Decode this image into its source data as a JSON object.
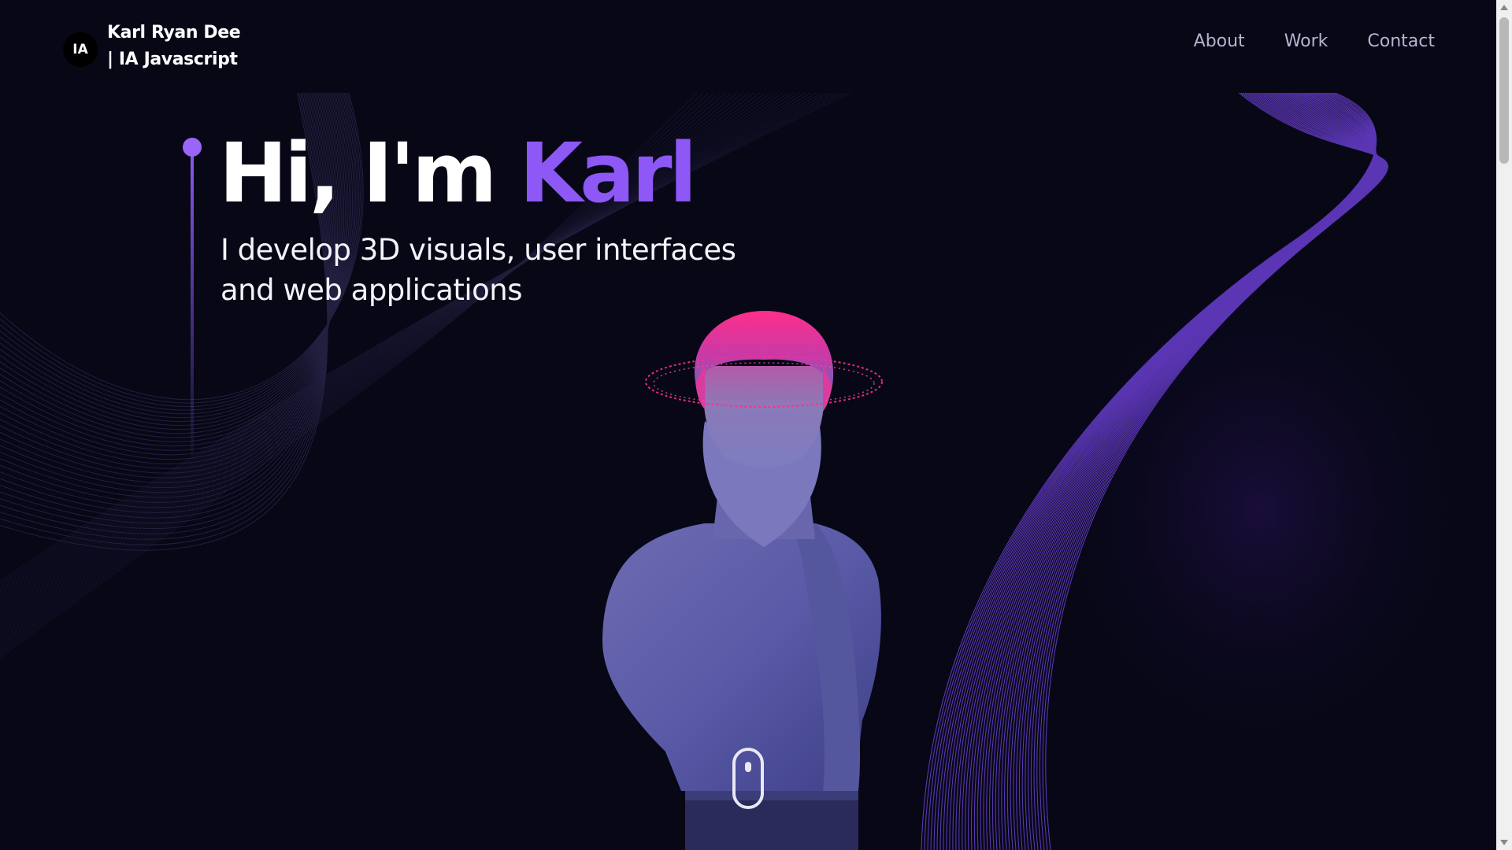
{
  "header": {
    "logo_badge": "IA",
    "logo_line1": "Karl Ryan Dee",
    "logo_line2": "| IA Javascript",
    "nav": [
      {
        "label": "About"
      },
      {
        "label": "Work"
      },
      {
        "label": "Contact"
      }
    ]
  },
  "hero": {
    "title_prefix": "Hi, I'm ",
    "title_highlight": "Karl",
    "subtitle": "I develop 3D visuals, user interfaces and web applications"
  },
  "colors": {
    "background": "#070716",
    "accent": "#8d58f5",
    "halo": "#ff2e8a",
    "text": "#ffffff",
    "nav_text": "#b7b3cf"
  },
  "icons": {
    "scroll": "mouse-scroll-icon"
  }
}
